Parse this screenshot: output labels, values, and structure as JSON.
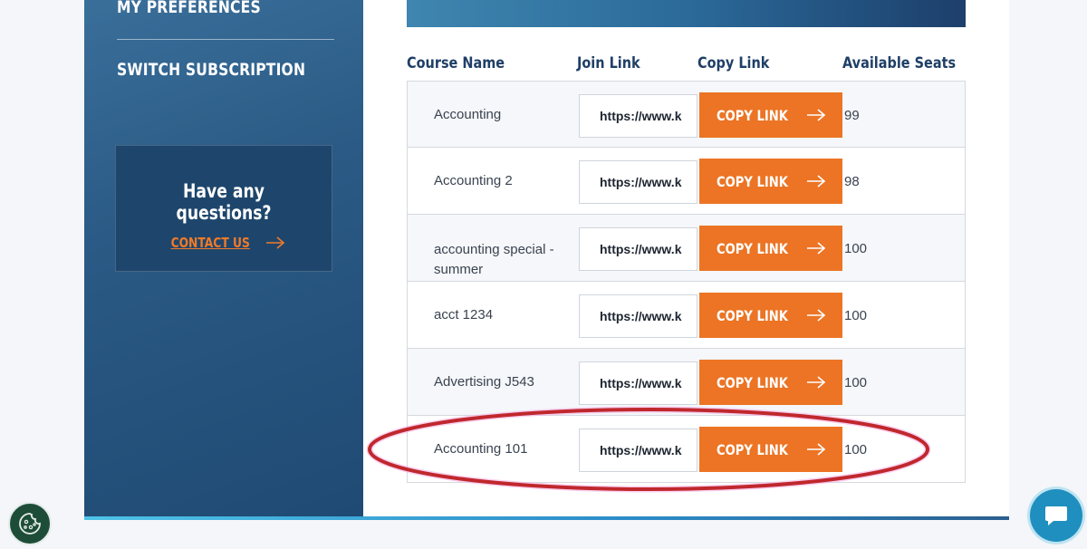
{
  "sidebar": {
    "nav": [
      {
        "label": "MY PREFERENCES"
      },
      {
        "label": "SWITCH SUBSCRIPTION"
      }
    ],
    "help": {
      "title": "Have any questions?",
      "contact_label": "CONTACT US"
    }
  },
  "table": {
    "headers": [
      "Course Name",
      "Join Link",
      "Copy Link",
      "Available Seats"
    ],
    "rows": [
      {
        "course": "Accounting",
        "link": "https://www.k",
        "button": "COPY LINK",
        "seats": "99"
      },
      {
        "course": "Accounting 2",
        "link": "https://www.k",
        "button": "COPY LINK",
        "seats": "98"
      },
      {
        "course": "accounting special - summer",
        "link": "https://www.k",
        "button": "COPY LINK",
        "seats": "100"
      },
      {
        "course": "acct 1234",
        "link": "https://www.k",
        "button": "COPY LINK",
        "seats": "100"
      },
      {
        "course": "Advertising J543",
        "link": "https://www.k",
        "button": "COPY LINK",
        "seats": "100"
      },
      {
        "course": "Accounting 101",
        "link": "https://www.k",
        "button": "COPY LINK",
        "seats": "100"
      }
    ]
  },
  "colors": {
    "accent": "#ec7424",
    "sidebar": "#2a5a85",
    "heading": "#1f3f66",
    "highlight_ellipse": "#c0282d"
  },
  "icons": [
    "arrow-right-icon",
    "cookie-icon",
    "chat-icon"
  ]
}
